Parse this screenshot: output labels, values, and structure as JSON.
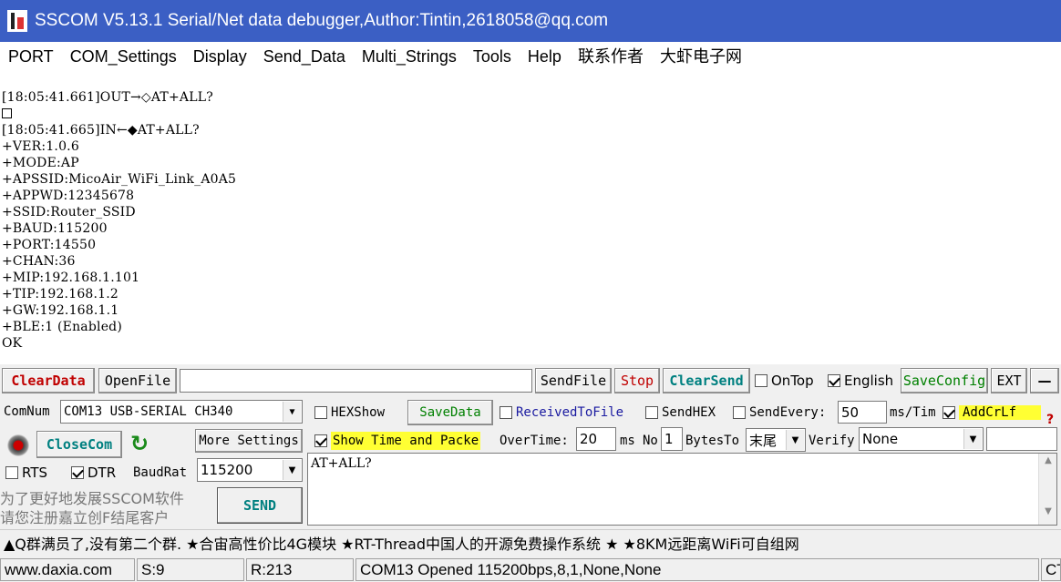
{
  "window": {
    "title": "SSCOM V5.13.1 Serial/Net data debugger,Author:Tintin,2618058@qq.com"
  },
  "menu": [
    "PORT",
    "COM_Settings",
    "Display",
    "Send_Data",
    "Multi_Strings",
    "Tools",
    "Help",
    "联系作者",
    "大虾电子网"
  ],
  "output": {
    "lines": [
      "[18:05:41.661]OUT→◇AT+ALL?",
      "",
      "[18:05:41.665]IN←◆AT+ALL?",
      "+VER:1.0.6",
      "+MODE:AP",
      "+APSSID:MicoAir_WiFi_Link_A0A5",
      "+APPWD:12345678",
      "+SSID:Router_SSID",
      "+BAUD:115200",
      "+PORT:14550",
      "+CHAN:36",
      "+MIP:192.168.1.101",
      "+TIP:192.168.1.2",
      "+GW:192.168.1.1",
      "+BLE:1 (Enabled)",
      "OK"
    ]
  },
  "toolbar": {
    "clear_data": "ClearData",
    "open_file": "OpenFile",
    "file_path": "",
    "send_file": "SendFile",
    "stop": "Stop",
    "clear_send": "ClearSend",
    "on_top": "OnTop",
    "english": "English",
    "save_config": "SaveConfig",
    "ext": "EXT",
    "minus": "—"
  },
  "port": {
    "com_num_label": "ComNum",
    "com_port": "COM13 USB-SERIAL CH340",
    "close_com": "CloseCom",
    "more_settings": "More Settings",
    "rts": "RTS",
    "dtr": "DTR",
    "baud_label": "BaudRat",
    "baud": "115200"
  },
  "options": {
    "hex_show": "HEXShow",
    "save_data": "SaveData",
    "received_to_file": "ReceivedToFile",
    "send_hex": "SendHEX",
    "send_every": "SendEvery:",
    "send_every_value": "50",
    "ms_tim": "ms/Tim",
    "add_crlf": "AddCrLf",
    "show_time": "Show Time and Packe",
    "overtime": "OverTime:",
    "overtime_value": "20",
    "ms": "ms",
    "no": "No",
    "no_value": "1",
    "bytes_to": "BytesTo",
    "bytes_to_value": "末尾",
    "verify": "Verify",
    "verify_value": "None",
    "help_mark": "?"
  },
  "send": {
    "text": "AT+ALL?",
    "button": "SEND"
  },
  "promo": {
    "line1": "为了更好地发展SSCOM软件",
    "line2": "请您注册嘉立创F结尾客户"
  },
  "ticker": "▲Q群满员了,没有第二个群. ★合宙高性价比4G模块 ★RT-Thread中国人的开源免费操作系统 ★ ★8KM远距离WiFi可自组网",
  "status": {
    "site": "www.daxia.com",
    "sent": "S:9",
    "received": "R:213",
    "port_status": "COM13 Opened  115200bps,8,1,None,None",
    "cts": "CT"
  },
  "colors": {
    "title_bg": "#3b5fc4",
    "clear_data": "#c00000",
    "clear_send": "#008080",
    "highlight": "#ffff33",
    "send_btn": "#008080"
  }
}
